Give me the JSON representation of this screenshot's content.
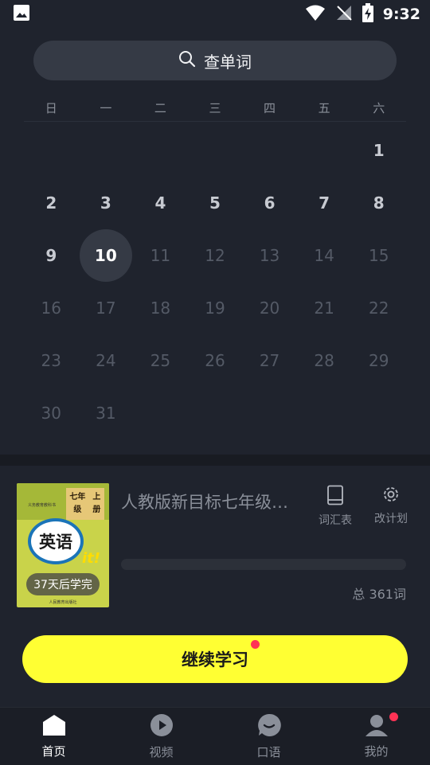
{
  "status_bar": {
    "time": "9:32"
  },
  "search": {
    "label": "查单词"
  },
  "calendar": {
    "weekdays": [
      "日",
      "一",
      "二",
      "三",
      "四",
      "五",
      "六"
    ],
    "leading_blanks": 6,
    "days": [
      "1",
      "2",
      "3",
      "4",
      "5",
      "6",
      "7",
      "8",
      "9",
      "10",
      "11",
      "12",
      "13",
      "14",
      "15",
      "16",
      "17",
      "18",
      "19",
      "20",
      "21",
      "22",
      "23",
      "24",
      "25",
      "26",
      "27",
      "28",
      "29",
      "30",
      "31"
    ],
    "today": "10"
  },
  "book": {
    "title": "人教版新目标七年级上册",
    "cover": {
      "series": "义务教育教科书",
      "grade": "七年级",
      "volume": "上册",
      "subject": "英语",
      "logo": "it!",
      "publisher": "人民教育出版社",
      "badge": "37天后学完"
    },
    "actions": {
      "wordlist": "词汇表",
      "edit_plan": "改计划"
    },
    "progress": 0,
    "total": "总 361词"
  },
  "continue": {
    "label": "继续学习"
  },
  "nav": {
    "items": [
      {
        "label": "首页",
        "icon": "home-icon",
        "active": true
      },
      {
        "label": "视频",
        "icon": "play-icon",
        "active": false
      },
      {
        "label": "口语",
        "icon": "chat-icon",
        "active": false
      },
      {
        "label": "我的",
        "icon": "user-icon",
        "active": false
      }
    ]
  },
  "colors": {
    "background": "#1f232d",
    "accent": "#ffff33",
    "badge_red": "#ff3355",
    "muted_text": "#8a8f99"
  }
}
